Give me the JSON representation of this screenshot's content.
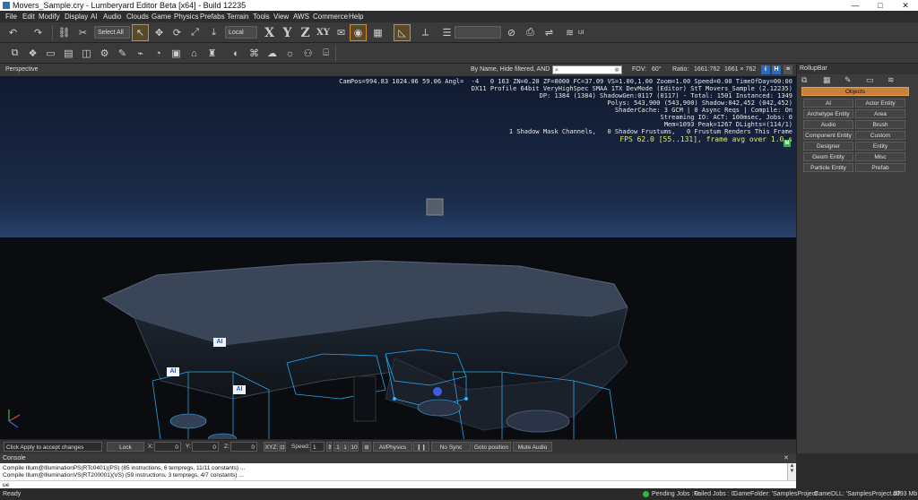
{
  "window": {
    "title": "Movers_Sample.cry - Lumberyard Editor Beta [x64] - Build 12235",
    "minimize": "—",
    "maximize": "□",
    "close": "✕"
  },
  "menu": [
    "File",
    "Edit",
    "Modify",
    "Display",
    "AI",
    "Audio",
    "Clouds",
    "Game",
    "Physics",
    "Prefabs",
    "Terrain",
    "Tools",
    "View",
    "AWS",
    "Commerce",
    "Help"
  ],
  "toolbar": {
    "select_all": "Select All",
    "coord_space": "Local",
    "axis_x": "X",
    "axis_y": "Y",
    "axis_z": "Z",
    "axis_xy": "XY",
    "ui_label": "UI",
    "icons": [
      "undo-icon",
      "redo-icon",
      "link-icon",
      "unlink-icon",
      "select-arrow-icon",
      "move-icon",
      "rotate-icon",
      "scale-icon",
      "snap-icon",
      "terrain-snap-icon",
      "lock-icon",
      "layers-icon",
      "grid-icon",
      "angle-icon",
      "list-icon",
      "toggle-icon"
    ]
  },
  "viewport": {
    "name": "Perspective",
    "search_filter": "By Name, Hide filtered, AND",
    "fov_label": "FOV:",
    "fov_value": "60°",
    "ratio_label": "Ratio:",
    "ratio_value": "1661:762",
    "resolution": "1661 × 762",
    "btn_i": "i",
    "btn_h": "H",
    "hud": {
      "line1": "CamPos=994.83 1024.06 59.06 Angl=  -4   0 163 ZN=0.20 ZF=8000 FC=37.09 VS=1.00,1.00 Zoom=1.00 Speed=0.00 TimeOfDay=00:00",
      "line2": "DX11 Profile 64bit VeryHighSpec SMAA 1TX DevMode (Editor) StT Movers_Sample (2.12235)",
      "line3": "DP: 1384 (1384) ShadowGen:0117 (0117) - Total: 1501 Instanced: 1349",
      "line4": "Polys: 543,900 (543,900) Shadow:042,452 (042,452)",
      "line5": "ShaderCache: 3 GCM | 0 Async Reqs | Compile: On",
      "line6": "Streaming IO: ACT: 100msec, Jobs: 0",
      "line7": "Mem=1093 Peak=1267 DLights=(114/1)",
      "line8": "1 Shadow Mask Channels,   0 Shadow Frustums,   0 Frustum Renders This Frame",
      "fps": "FPS 62.0 [55..131], frame avg over 1.0 s",
      "marker": "M"
    },
    "ai_tag": "AI"
  },
  "rollup": {
    "title": "RollupBar",
    "category": "Objects",
    "buttons": [
      [
        "AI",
        "Actor Entity"
      ],
      [
        "Archetype Entity",
        "Area"
      ],
      [
        "Audio",
        "Brush"
      ],
      [
        "Component Entity",
        "Custom"
      ],
      [
        "Designer",
        "Entity"
      ],
      [
        "Geom Entity",
        "Misc"
      ],
      [
        "Particle Entity",
        "Prefab"
      ]
    ]
  },
  "statusstrip": {
    "hint": "Click Apply to accept changes",
    "lock_selection": "Lock Selection",
    "x_label": "X:",
    "x_value": "0",
    "y_label": "Y:",
    "y_value": "0",
    "z_label": "Z:",
    "z_value": "0",
    "xyz": "XYZ",
    "speed_label": "Speed:",
    "speed_value": "1",
    "speed_opts": [
      ".1",
      "1",
      "10"
    ],
    "ai_physics": "AI/Physics",
    "no_sync_player": "No Sync Player",
    "goto_position": "Goto position",
    "mute_audio": "Mute Audio"
  },
  "console": {
    "title": "Console",
    "lines": [
      "Compile Illum@IlluminationPS(RTc0401)(PS) (85 instructions, 6 tempregs, 11/11 constants) ...",
      "Compile Illum@IlluminationVS(RT200001)(VS) (59 instructions, 3 tempregs, 4/7 constants) ..."
    ],
    "prompt": "ue"
  },
  "status": {
    "ready": "Ready",
    "pending_jobs": "Pending Jobs : 0",
    "failed_jobs": "Failed Jobs : 0",
    "game_folder": "GameFolder: 'SamplesProject'",
    "game_dll": "GameDLL: 'SamplesProject.dll'",
    "memory": "1093 Mb"
  },
  "colors": {
    "accent": "#d8892b",
    "selection": "#2a6bbf",
    "fps_text": "#e8e860",
    "ok_green": "#2fb845"
  }
}
